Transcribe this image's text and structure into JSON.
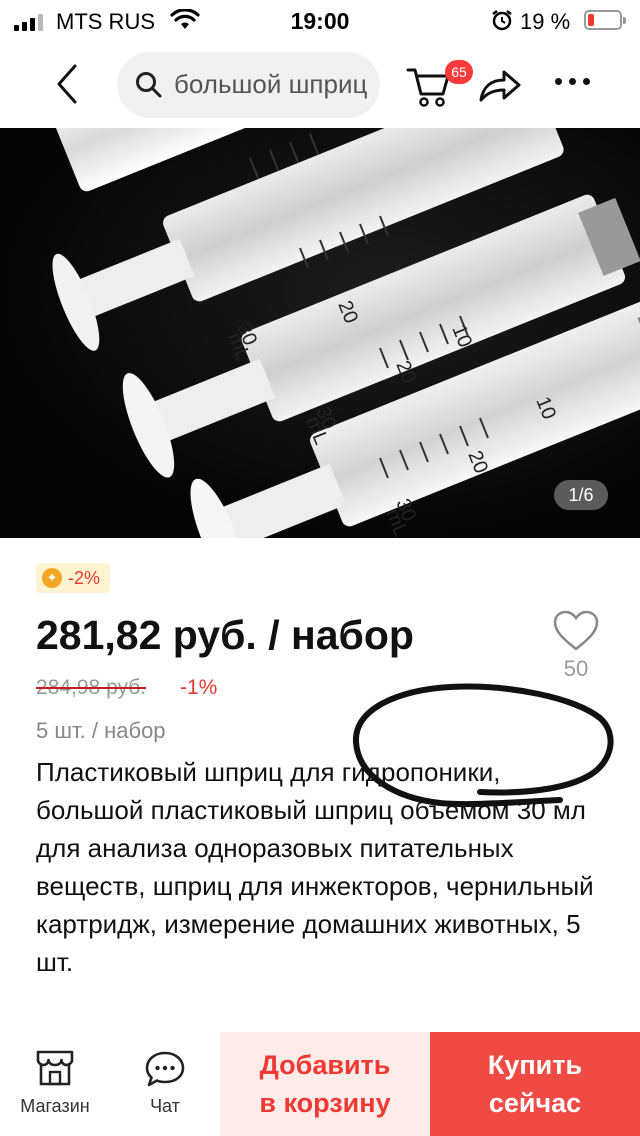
{
  "status_bar": {
    "carrier": "MTS RUS",
    "time": "19:00",
    "battery_percent": "19 %"
  },
  "nav": {
    "search_query": "большой шприц",
    "cart_badge": "65",
    "icons": [
      "back-arrow-icon",
      "search-icon",
      "cart-icon",
      "share-icon",
      "more-icon"
    ]
  },
  "gallery": {
    "counter": "1/6",
    "syringe_marks": [
      "10",
      "20",
      "30",
      "mL"
    ]
  },
  "product": {
    "coupon": "-2%",
    "price": "281,82 руб. / набор",
    "old_price": "284,98 руб.",
    "discount": "-1%",
    "favorites_count": "50",
    "units": "5 шт. / набор",
    "title": "Пластиковый шприц для гидропоники, большой пластиковый шприц объемом 30 мл для анализа одноразовых питательных веществ, шприц для инжекторов, чернильный картридж, измерение домашних животных, 5 шт."
  },
  "bottom_bar": {
    "store_label": "Магазин",
    "chat_label": "Чат",
    "add_to_cart": "Добавить\nв корзину",
    "buy_now": "Купить\nсейчас"
  },
  "colors": {
    "accent_red": "#f04a44",
    "light_red": "#fdecea",
    "badge_red": "#ff3b3b",
    "coupon_bg": "#fff4cf"
  }
}
